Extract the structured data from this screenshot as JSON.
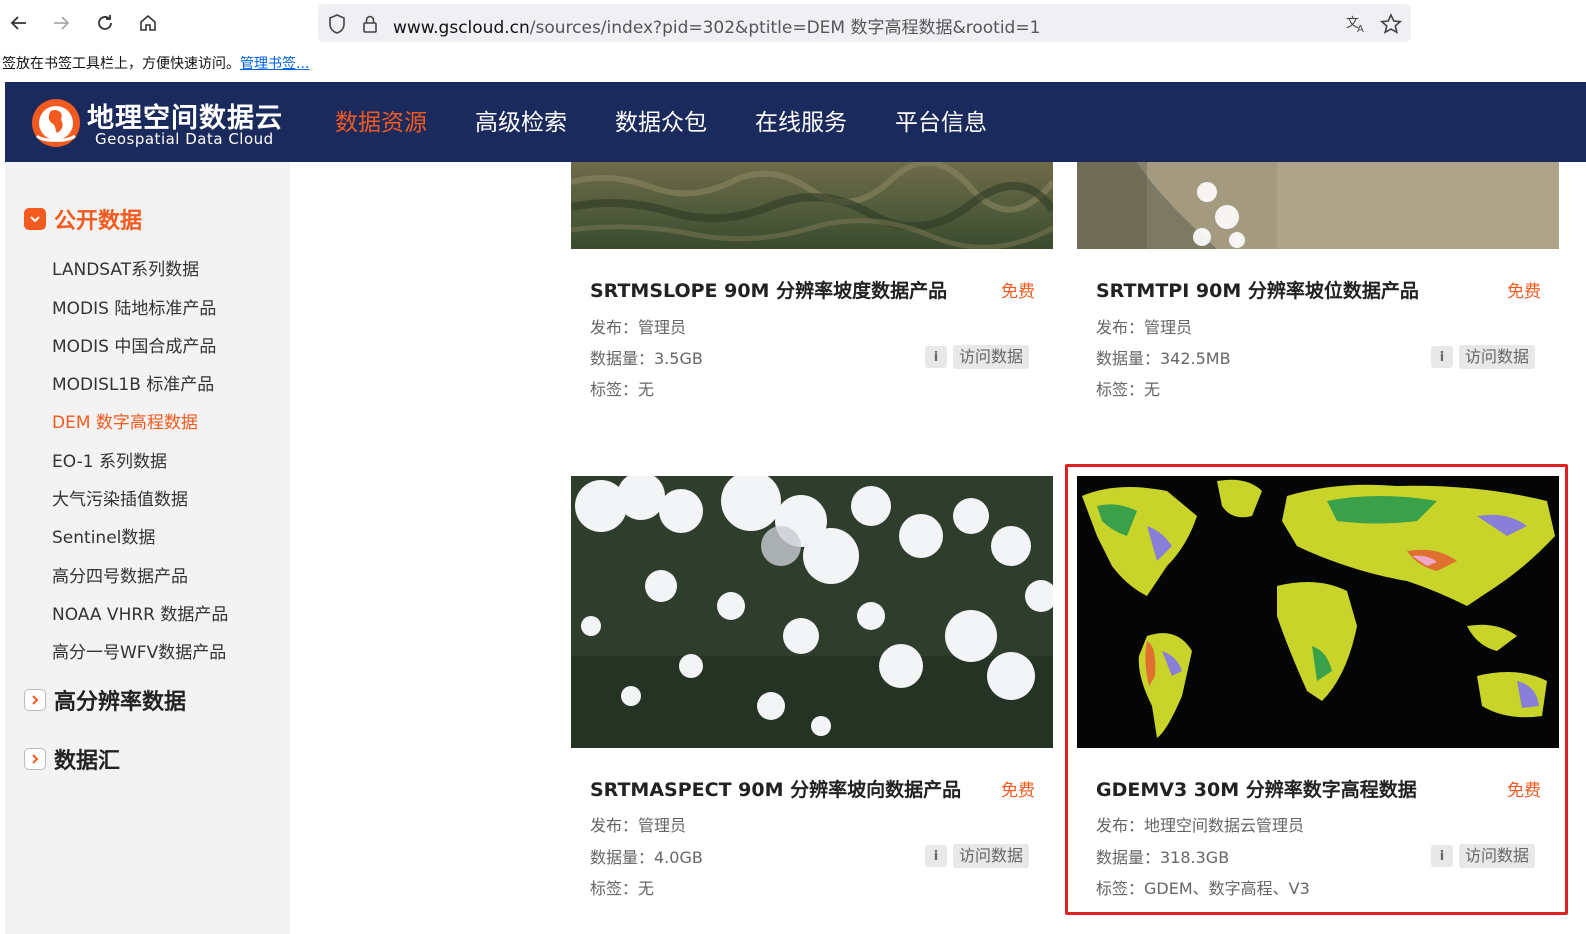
{
  "browser": {
    "url_domain": "www.gscloud.cn",
    "url_rest": "/sources/index?pid=302&ptitle=DEM 数字高程数据&rootid=1",
    "url_prefix": "www."
  },
  "bookmark_bar": {
    "text": "签放在书签工具栏上，方便快速访问。",
    "link": "管理书签..."
  },
  "header": {
    "logo_main": "地理空间数据云",
    "logo_sub": "Geospatial Data Cloud",
    "nav": [
      "数据资源",
      "高级检索",
      "数据众包",
      "在线服务",
      "平台信息"
    ]
  },
  "sidebar": {
    "open_category": "公开数据",
    "items": [
      "LANDSAT系列数据",
      "MODIS 陆地标准产品",
      "MODIS 中国合成产品",
      "MODISL1B 标准产品",
      "DEM 数字高程数据",
      "EO-1 系列数据",
      "大气污染插值数据",
      "Sentinel数据",
      "高分四号数据产品",
      "NOAA VHRR 数据产品",
      "高分一号WFV数据产品"
    ],
    "closed_categories": [
      "高分辨率数据",
      "数据汇"
    ]
  },
  "cards": [
    {
      "title": "SRTMSLOPE 90M 分辨率坡度数据产品",
      "price": "免费",
      "publisher": "发布：管理员",
      "size": "数据量：3.5GB",
      "tags": "标签：无",
      "visit": "访问数据",
      "info": "i"
    },
    {
      "title": "SRTMTPI 90M 分辨率坡位数据产品",
      "price": "免费",
      "publisher": "发布：管理员",
      "size": "数据量：342.5MB",
      "tags": "标签：无",
      "visit": "访问数据",
      "info": "i"
    },
    {
      "title": "SRTMASPECT 90M 分辨率坡向数据产品",
      "price": "免费",
      "publisher": "发布：管理员",
      "size": "数据量：4.0GB",
      "tags": "标签：无",
      "visit": "访问数据",
      "info": "i"
    },
    {
      "title": "GDEMV3 30M 分辨率数字高程数据",
      "price": "免费",
      "publisher": "发布：地理空间数据云管理员",
      "size": "数据量：318.3GB",
      "tags": "标签：GDEM、数字高程、V3",
      "visit": "访问数据",
      "info": "i"
    }
  ],
  "colors": {
    "accent": "#f25a1f",
    "header_bg": "#1b2a5c",
    "highlight": "#e02020"
  }
}
